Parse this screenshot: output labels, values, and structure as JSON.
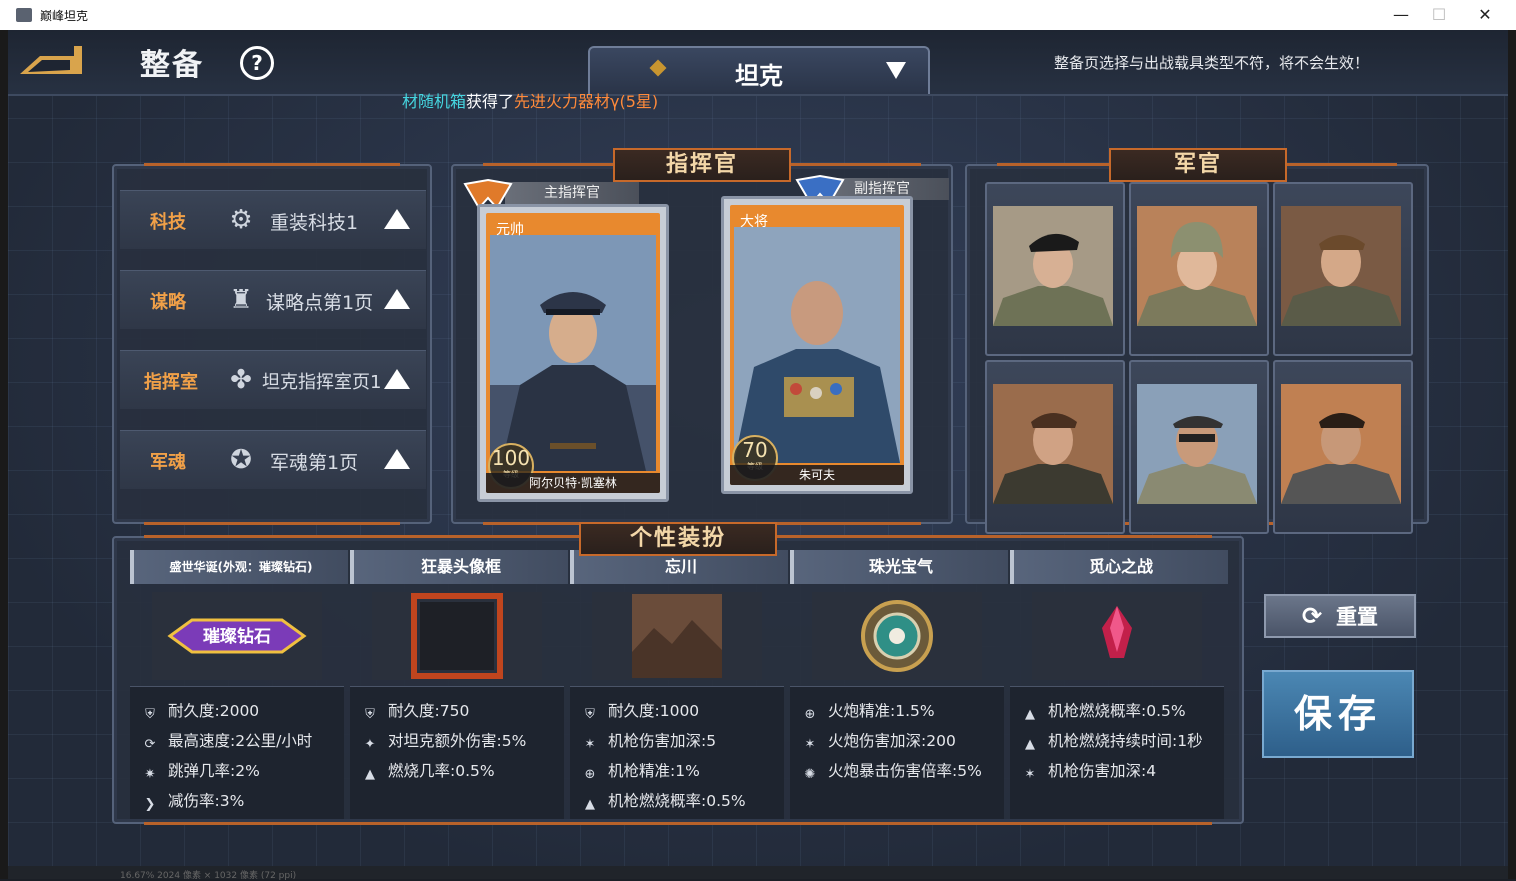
{
  "window": {
    "title": "巅峰坦克"
  },
  "header": {
    "title": "整备",
    "help_icon": "?",
    "vehicle_type": "坦克",
    "warning": "整备页选择与出战载具类型不符，将不会生效！"
  },
  "ticker": {
    "part1": "材随机箱",
    "part2": "获得了",
    "part3": "先进火力器材γ(5星)"
  },
  "left_panel": {
    "rows": [
      {
        "category": "科技",
        "value": "重装科技1",
        "icon": "tech-icon"
      },
      {
        "category": "谋略",
        "value": "谋略点第1页",
        "icon": "strategy-icon"
      },
      {
        "category": "指挥室",
        "value": "坦克指挥室页1",
        "icon": "command-room-icon"
      },
      {
        "category": "军魂",
        "value": "军魂第1页",
        "icon": "soul-icon"
      }
    ]
  },
  "commander_panel": {
    "label": "指挥官",
    "main": {
      "role": "主指挥官",
      "rank": "元帅",
      "level": "100",
      "level_unit": "等级",
      "name": "阿尔贝特·凯塞林"
    },
    "deputy": {
      "role": "副指挥官",
      "rank": "大将",
      "level": "70",
      "level_unit": "等级",
      "name": "朱可夫"
    }
  },
  "officer_panel": {
    "label": "军官",
    "slots": 6
  },
  "customization": {
    "label": "个性装扮",
    "columns": [
      {
        "name": "盛世华诞(外观：璀璨钻石)",
        "badge_text": "璀璨钻石",
        "stats": [
          {
            "icon": "shield-icon",
            "text": "耐久度:2000"
          },
          {
            "icon": "speed-icon",
            "text": "最高速度:2公里/小时"
          },
          {
            "icon": "ricochet-icon",
            "text": "跳弹几率:2%"
          },
          {
            "icon": "damage-reduce-icon",
            "text": "减伤率:3%"
          }
        ]
      },
      {
        "name": "狂暴头像框",
        "stats": [
          {
            "icon": "shield-icon",
            "text": "耐久度:750"
          },
          {
            "icon": "tank-damage-icon",
            "text": "对坦克额外伤害:5%"
          },
          {
            "icon": "burn-icon",
            "text": "燃烧几率:0.5%"
          }
        ]
      },
      {
        "name": "忘川",
        "stats": [
          {
            "icon": "shield-icon",
            "text": "耐久度:1000"
          },
          {
            "icon": "mg-damage-icon",
            "text": "机枪伤害加深:5"
          },
          {
            "icon": "crosshair-icon",
            "text": "机枪精准:1%"
          },
          {
            "icon": "burn-icon",
            "text": "机枪燃烧概率:0.5%"
          }
        ]
      },
      {
        "name": "珠光宝气",
        "stats": [
          {
            "icon": "crosshair-icon",
            "text": "火炮精准:1.5%"
          },
          {
            "icon": "cannon-damage-icon",
            "text": "火炮伤害加深:200"
          },
          {
            "icon": "crit-icon",
            "text": "火炮暴击伤害倍率:5%"
          }
        ]
      },
      {
        "name": "觅心之战",
        "stats": [
          {
            "icon": "burn-icon",
            "text": "机枪燃烧概率:0.5%"
          },
          {
            "icon": "burn-icon",
            "text": "机枪燃烧持续时间:1秒"
          },
          {
            "icon": "mg-damage-icon",
            "text": "机枪伤害加深:4"
          }
        ]
      }
    ]
  },
  "buttons": {
    "reset": "重置",
    "save": "保存"
  },
  "statusbar": {
    "text": "16.67%    2024 像素 × 1032 像素 (72 ppi)"
  },
  "colors": {
    "accent_orange": "#c7692a",
    "category_orange": "#f0a048",
    "ticker_cyan": "#45d6e0",
    "ticker_orange": "#ff8a3a",
    "save_blue": "#3d75a2"
  }
}
